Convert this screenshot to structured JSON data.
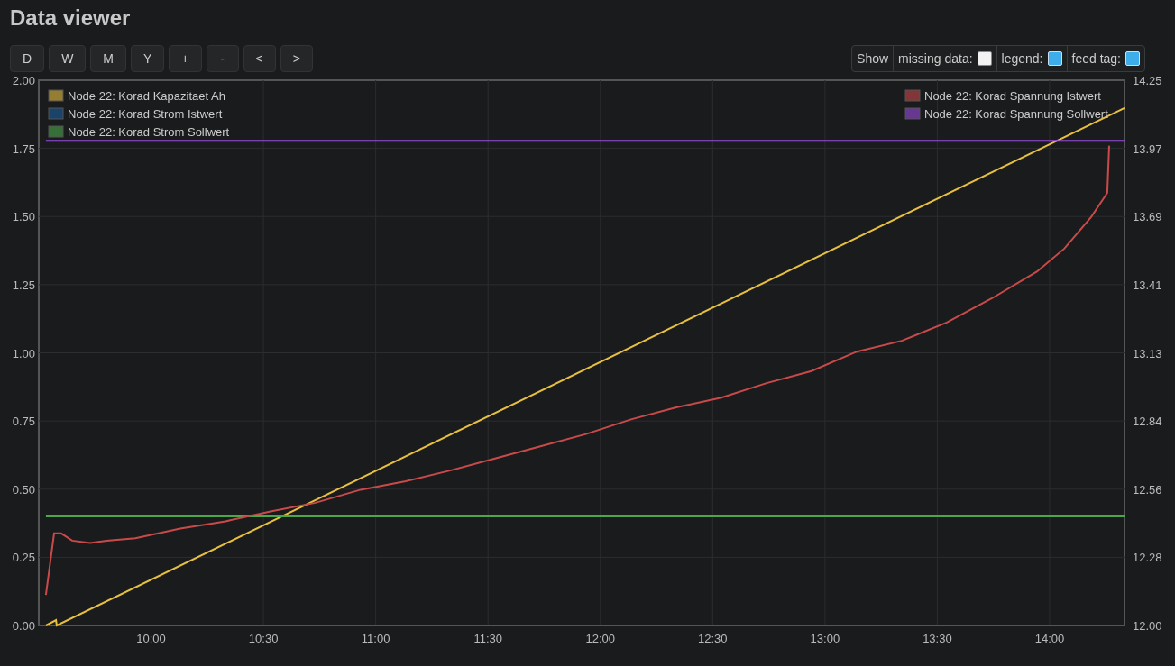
{
  "title": "Data viewer",
  "toolbar": {
    "buttons": [
      "D",
      "W",
      "M",
      "Y",
      "+",
      "-",
      "<",
      ">"
    ],
    "show_label": "Show",
    "options": [
      {
        "label": "missing data:",
        "checked": false
      },
      {
        "label": "legend:",
        "checked": true
      },
      {
        "label": "feed tag:",
        "checked": true
      }
    ]
  },
  "chart": {
    "chart_data": {
      "type": "line",
      "grid": true,
      "legend": "top",
      "xlim": [
        570,
        860
      ],
      "ylim": [
        0,
        2
      ],
      "y2lim": [
        12,
        14.25
      ],
      "xticks": [
        {
          "value": 600,
          "label": "10:00"
        },
        {
          "value": 630,
          "label": "10:30"
        },
        {
          "value": 660,
          "label": "11:00"
        },
        {
          "value": 690,
          "label": "11:30"
        },
        {
          "value": 720,
          "label": "12:00"
        },
        {
          "value": 750,
          "label": "12:30"
        },
        {
          "value": 780,
          "label": "13:00"
        },
        {
          "value": 810,
          "label": "13:30"
        },
        {
          "value": 840,
          "label": "14:00"
        }
      ],
      "yticks": [
        {
          "value": 0,
          "label": "0.00"
        },
        {
          "value": 0.25,
          "label": "0.25"
        },
        {
          "value": 0.5,
          "label": "0.50"
        },
        {
          "value": 0.75,
          "label": "0.75"
        },
        {
          "value": 1,
          "label": "1.00"
        },
        {
          "value": 1.25,
          "label": "1.25"
        },
        {
          "value": 1.5,
          "label": "1.50"
        },
        {
          "value": 1.75,
          "label": "1.75"
        },
        {
          "value": 2,
          "label": "2.00"
        }
      ],
      "y2ticks": [
        {
          "value": 12,
          "label": "12.00"
        },
        {
          "value": 12.28125,
          "label": "12.28"
        },
        {
          "value": 12.5625,
          "label": "12.56"
        },
        {
          "value": 12.84375,
          "label": "12.84"
        },
        {
          "value": 13.125,
          "label": "13.13"
        },
        {
          "value": 13.40625,
          "label": "13.41"
        },
        {
          "value": 13.6875,
          "label": "13.69"
        },
        {
          "value": 13.96875,
          "label": "13.97"
        },
        {
          "value": 14.25,
          "label": "14.25"
        }
      ],
      "series": [
        {
          "name": "Node 22: Korad Kapazitaet Ah",
          "color": "#e8c040",
          "x": [
            571.9,
            574.6,
            574.8,
            860
          ],
          "values": [
            0,
            0.02,
            0,
            1.898
          ]
        },
        {
          "name": "Node 22: Korad Strom Istwert",
          "color": "#1a5fa0"
        },
        {
          "name": "Node 22: Korad Strom Sollwert",
          "color": "#4aa84a",
          "x": [
            571.9,
            860
          ],
          "values": [
            0.4,
            0.4
          ]
        },
        {
          "name": "Node 22: Korad Spannung Istwert",
          "color": "#c94a4a",
          "axis": "y2",
          "x": [
            571.9,
            574.1,
            576.0,
            578.9,
            583.7,
            588.1,
            595.8,
            607.8,
            619.9,
            631.9,
            643.9,
            656.0,
            668.0,
            680.1,
            692.1,
            704.2,
            716.2,
            728.2,
            740.3,
            752.3,
            764.4,
            776.4,
            788.5,
            800.5,
            812.5,
            824.6,
            836.6,
            843.9,
            851.1,
            855.4,
            855.9
          ],
          "values": [
            12.126,
            12.38,
            12.38,
            12.35,
            12.34,
            12.35,
            12.36,
            12.4,
            12.43,
            12.47,
            12.506,
            12.56,
            12.595,
            12.64,
            12.69,
            12.74,
            12.79,
            12.85,
            12.9,
            12.94,
            13.0,
            13.05,
            13.13,
            13.175,
            13.25,
            13.35,
            13.46,
            13.555,
            13.685,
            13.785,
            13.98
          ]
        },
        {
          "name": "Node 22: Korad Spannung Sollwert",
          "color": "#9b4de0",
          "axis": "y2",
          "x": [
            571.9,
            860
          ],
          "values": [
            14.0,
            14.0
          ]
        }
      ]
    }
  }
}
